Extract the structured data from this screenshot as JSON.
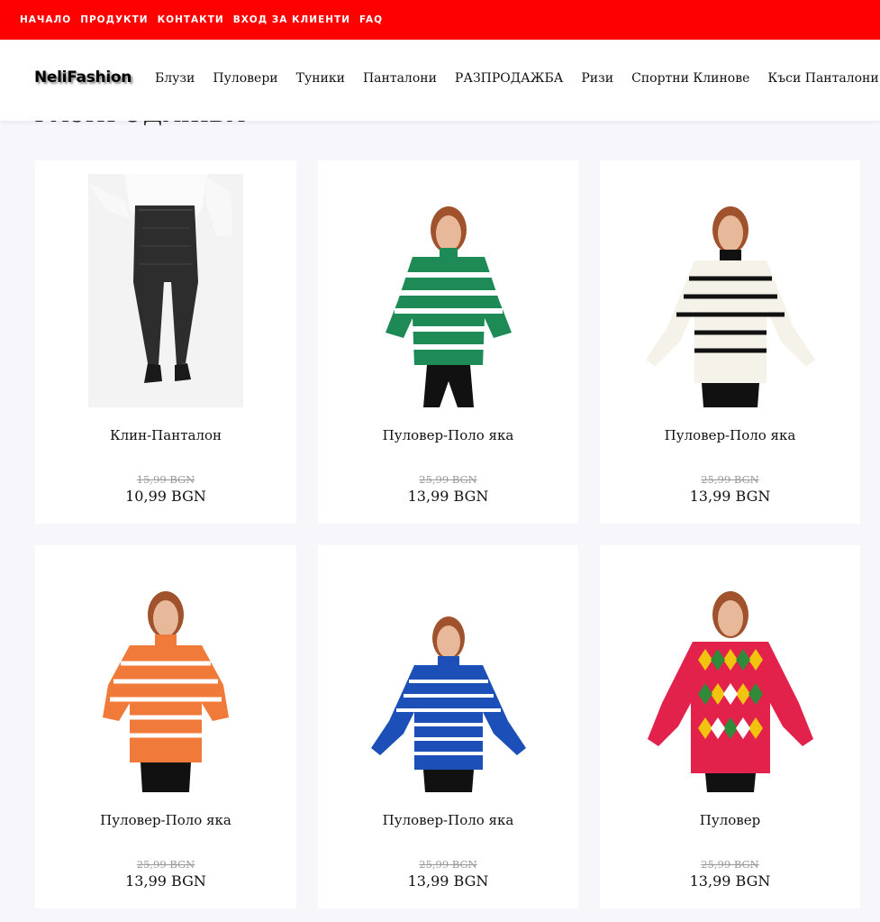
{
  "topbar": {
    "links": [
      "НАЧАЛО",
      "ПРОДУКТИ",
      "КОНТАКТИ",
      "ВХОД ЗА КЛИЕНТИ",
      "FAQ"
    ],
    "color": "#ff0000"
  },
  "header": {
    "logo": "NeliFashion",
    "nav": [
      "Блузи",
      "Пуловери",
      "Туники",
      "Панталони",
      "РАЗПРОДАЖБА",
      "Ризи",
      "Спортни Клинове",
      "Къси Панталони"
    ]
  },
  "page": {
    "heading": "РАЗПРОДАЖБА"
  },
  "products": [
    {
      "title": "Клин-Панталон",
      "old_price": "15,99 BGN",
      "new_price": "10,99 BGN",
      "image": "black-plaid-leggings"
    },
    {
      "title": "Пуловер-Поло яка",
      "old_price": "25,99 BGN",
      "new_price": "13,99 BGN",
      "image": "green-striped-sweater"
    },
    {
      "title": "Пуловер-Поло яка",
      "old_price": "25,99 BGN",
      "new_price": "13,99 BGN",
      "image": "white-black-striped-sweater"
    },
    {
      "title": "Пуловер-Поло яка",
      "old_price": "25,99 BGN",
      "new_price": "13,99 BGN",
      "image": "orange-striped-sweater"
    },
    {
      "title": "Пуловер-Поло яка",
      "old_price": "25,99 BGN",
      "new_price": "13,99 BGN",
      "image": "blue-striped-sweater"
    },
    {
      "title": "Пуловер",
      "old_price": "25,99 BGN",
      "new_price": "13,99 BGN",
      "image": "multicolor-diamond-sweater"
    }
  ]
}
